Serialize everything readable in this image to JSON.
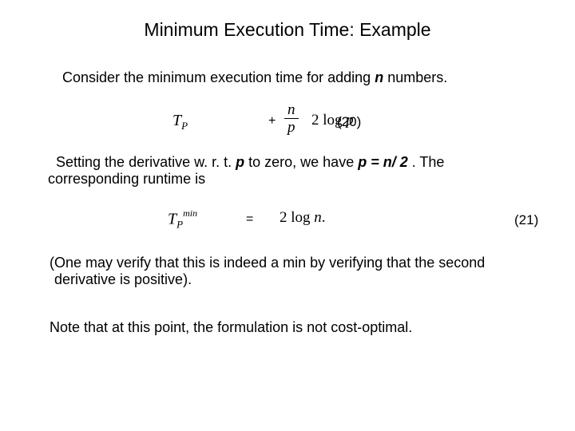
{
  "title": "Minimum Execution Time: Example",
  "p1_a": "Consider the minimum execution time for adding ",
  "p1_n": "n",
  "p1_b": "  numbers.",
  "eq20": {
    "lhs_T": "T",
    "lhs_P": "P",
    "plus": "+",
    "num": "n",
    "den": "p",
    "two": "2 ",
    "log": "log ",
    "p": "p",
    "ref": "(20)"
  },
  "p2_a": "Setting the derivative w. r. t. ",
  "p2_p1": "p",
  "p2_b": " to zero, we have ",
  "p2_p2": "p = n/ 2",
  "p2_c": " . The",
  "p2_d": "corresponding runtime is",
  "eq21": {
    "lhs_T": "T",
    "lhs_P": "P",
    "lhs_min": "min",
    "eq": "=",
    "two": "2 ",
    "log": "log ",
    "n": "n",
    "dot": ".",
    "ref": "(21)"
  },
  "p3_a": "(One may verify that this is indeed a min by verifying that the second",
  "p3_b": "derivative is positive).",
  "p4": "Note that at this point, the formulation is not cost-optimal."
}
